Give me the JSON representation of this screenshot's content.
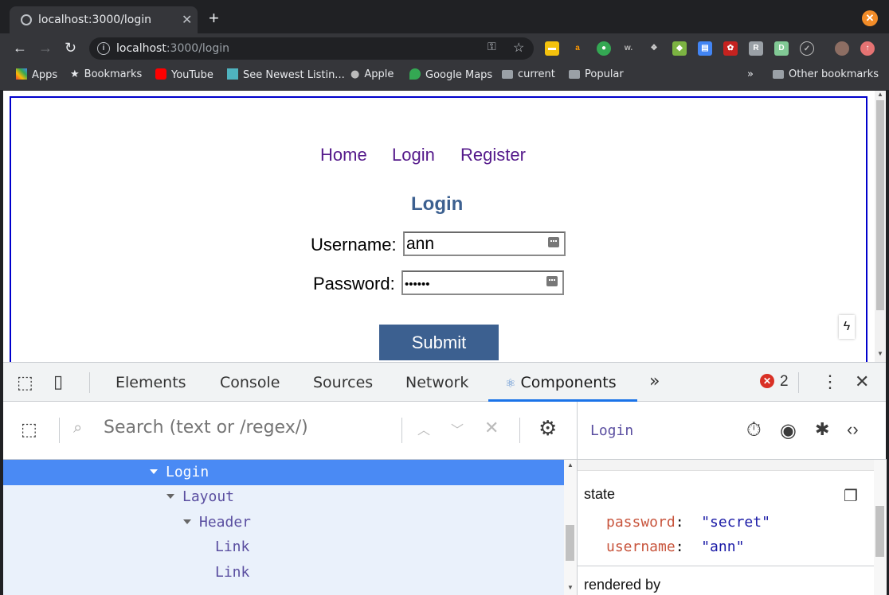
{
  "browser": {
    "tab_title": "localhost:3000/login",
    "url_host": "localhost",
    "url_rest": ":3000/login",
    "bookmarks": [
      "Apps",
      "Bookmarks",
      "YouTube",
      "See Newest Listin...",
      "Apple",
      "Google Maps",
      "current",
      "Popular"
    ],
    "other_bookmarks": "Other bookmarks",
    "overflow": "»"
  },
  "page": {
    "nav": [
      "Home",
      "Login",
      "Register"
    ],
    "heading": "Login",
    "username_label": "Username:",
    "username_value": "ann",
    "password_label": "Password:",
    "password_value": "••••••",
    "submit_label": "Submit"
  },
  "devtools": {
    "tabs": [
      "Elements",
      "Console",
      "Sources",
      "Network",
      "Components"
    ],
    "more": "»",
    "error_count": "2",
    "search_placeholder": "Search (text or /regex/)",
    "tree": [
      {
        "label": "Login",
        "expanded": true,
        "selected": true
      },
      {
        "label": "Layout",
        "expanded": true
      },
      {
        "label": "Header",
        "expanded": true
      },
      {
        "label": "Link"
      },
      {
        "label": "Link"
      }
    ],
    "selected_component": "Login",
    "state_label": "state",
    "state": [
      {
        "key": "password",
        "value": "\"secret\""
      },
      {
        "key": "username",
        "value": "\"ann\""
      }
    ],
    "rendered_by_label": "rendered by"
  },
  "colors": {
    "accent_blue": "#1a73e8",
    "selected_row": "#4a8af4",
    "submit_bg": "#3c6090",
    "frame_border": "#0000cc"
  }
}
